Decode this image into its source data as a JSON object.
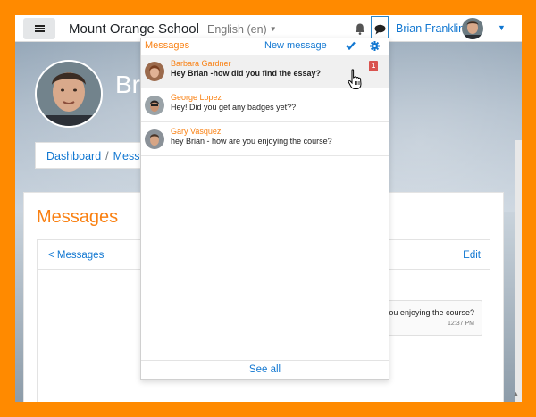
{
  "navbar": {
    "site_name": "Mount Orange School",
    "language": "English (en)",
    "user_name": "Brian Franklin"
  },
  "header": {
    "heading_partial": "Br",
    "breadcrumb": {
      "dashboard": "Dashboard",
      "separator": "/",
      "current": "Messa"
    }
  },
  "page": {
    "title": "Messages",
    "back_link": "< Messages",
    "edit_link": "Edit",
    "bubble_text": "you enjoying the course?",
    "bubble_time": "12:37 PM"
  },
  "popover": {
    "title": "Messages",
    "new_message": "New message",
    "conversations": [
      {
        "name": "Barbara Gardner",
        "text": "Hey Brian -how did you find the essay?",
        "unread": "1",
        "active": true
      },
      {
        "name": "George Lopez",
        "text": "Hey! Did you get any badges yet??",
        "active": false
      },
      {
        "name": "Gary Vasquez",
        "text": "hey Brian - how are you enjoying the course?",
        "active": false
      }
    ],
    "see_all": "See all"
  },
  "colors": {
    "accent": "#f98012",
    "link": "#1177d1",
    "frame": "#ff8a00",
    "badge": "#d9534f"
  }
}
